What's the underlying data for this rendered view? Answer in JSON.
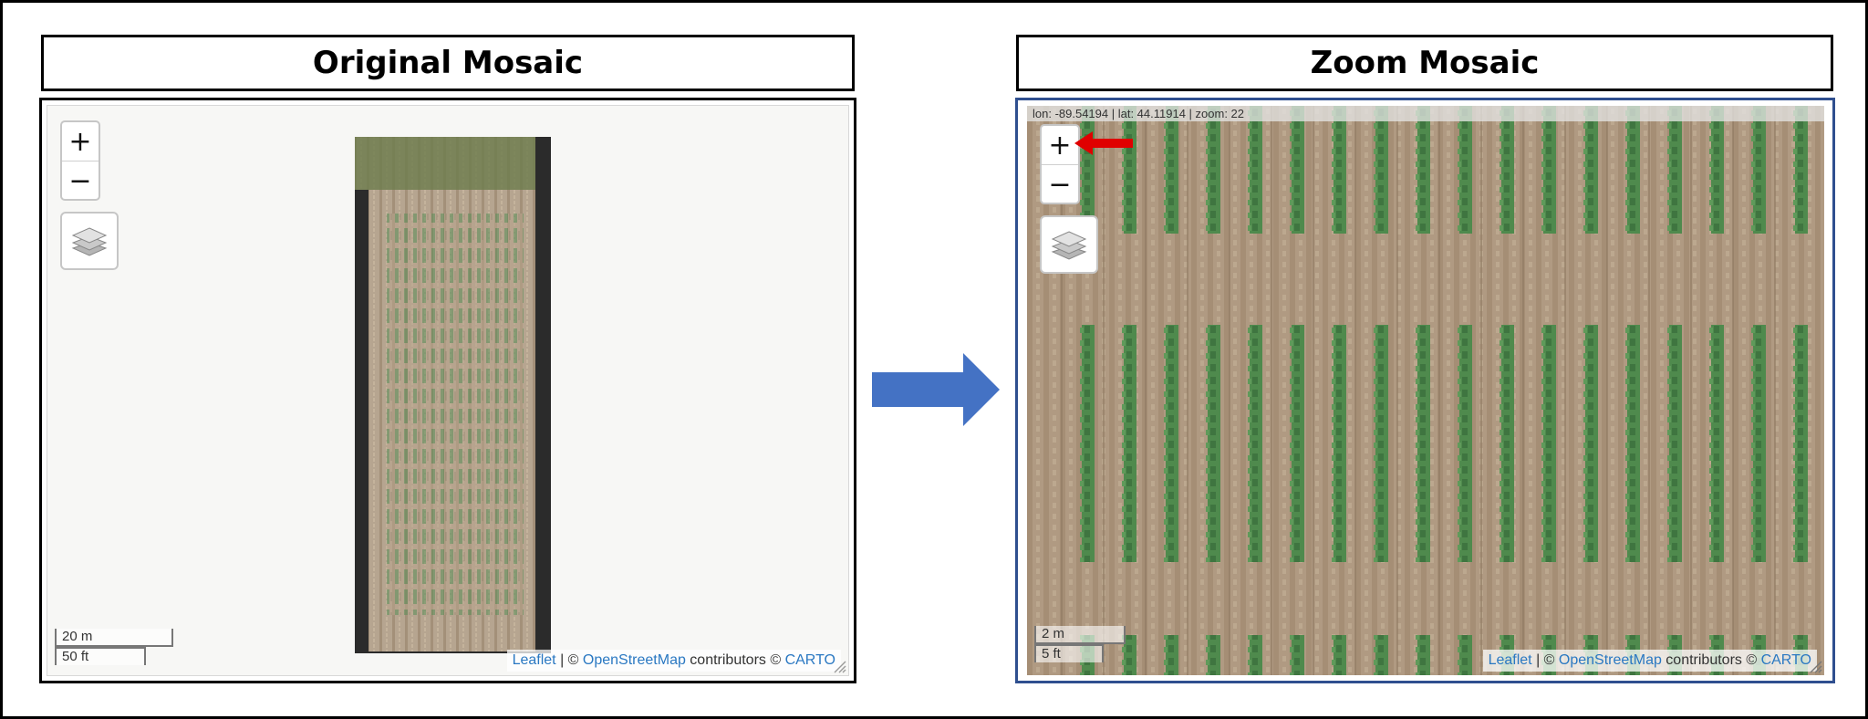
{
  "left_panel": {
    "title": "Original Mosaic",
    "zoom": {
      "in_label": "+",
      "out_label": "−"
    },
    "layers_icon": "layers-icon",
    "scale": {
      "metric": "20 m",
      "imperial": "50 ft"
    },
    "attribution": {
      "leaflet": "Leaflet",
      "sep": " | © ",
      "osm": "OpenStreetMap",
      "contributors": " contributors © ",
      "carto": "CARTO"
    }
  },
  "arrow": {
    "icon": "right-arrow-icon",
    "color": "#4472c4"
  },
  "right_panel": {
    "title": "Zoom Mosaic",
    "coordinates": "lon: -89.54194 | lat: 44.11914 | zoom: 22",
    "zoom": {
      "in_label": "+",
      "out_label": "−"
    },
    "highlight_arrow": {
      "icon": "red-arrow-icon",
      "color": "#e00000"
    },
    "layers_icon": "layers-icon",
    "scale": {
      "metric": "2 m",
      "imperial": "5 ft"
    },
    "attribution": {
      "leaflet": "Leaflet",
      "sep": " | © ",
      "osm": "OpenStreetMap",
      "contributors": " contributors © ",
      "carto": "CARTO"
    }
  },
  "colors": {
    "soil": "#b09a82",
    "crop": "#4f8a4d",
    "map_bg": "#f7f7f5",
    "leaflet_link": "#2a78c2"
  }
}
